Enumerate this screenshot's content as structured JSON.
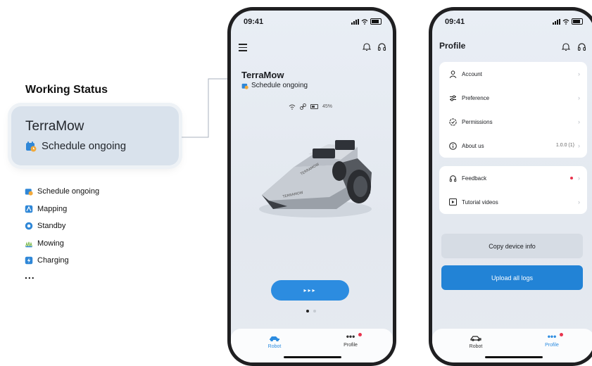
{
  "annotation": {
    "heading": "Working Status",
    "card_name": "TerraMow",
    "card_status": "Schedule ongoing",
    "legend": [
      {
        "label": "Schedule ongoing",
        "icon": "calendar-clock-icon"
      },
      {
        "label": "Mapping",
        "icon": "mapping-icon"
      },
      {
        "label": "Standby",
        "icon": "standby-icon"
      },
      {
        "label": "Mowing",
        "icon": "mowing-icon"
      },
      {
        "label": "Charging",
        "icon": "charging-icon"
      }
    ],
    "more": "..."
  },
  "robot_screen": {
    "time": "09:41",
    "device_name": "TerraMow",
    "device_status": "Schedule ongoing",
    "battery": "45%",
    "action_button": "▸▸▸",
    "pager": {
      "count": 2,
      "active": 1
    }
  },
  "profile_screen": {
    "time": "09:41",
    "title": "Profile",
    "menu_group_1": [
      {
        "label": "Account",
        "icon": "person-icon"
      },
      {
        "label": "Preference",
        "icon": "sliders-icon"
      },
      {
        "label": "Permissions",
        "icon": "shield-check-icon"
      },
      {
        "label": "About us",
        "icon": "info-icon",
        "value": "1.0.0 (1)"
      }
    ],
    "menu_group_2": [
      {
        "label": "Feedback",
        "icon": "headset-icon",
        "badge": true
      },
      {
        "label": "Tutorial videos",
        "icon": "video-icon"
      }
    ],
    "copy_button": "Copy device info",
    "upload_button": "Upload all logs"
  },
  "tabs": {
    "robot": "Robot",
    "profile": "Profile"
  },
  "colors": {
    "accent": "#2c8ce0",
    "badge": "#e8344e",
    "status_card": "#d9e2ec"
  }
}
